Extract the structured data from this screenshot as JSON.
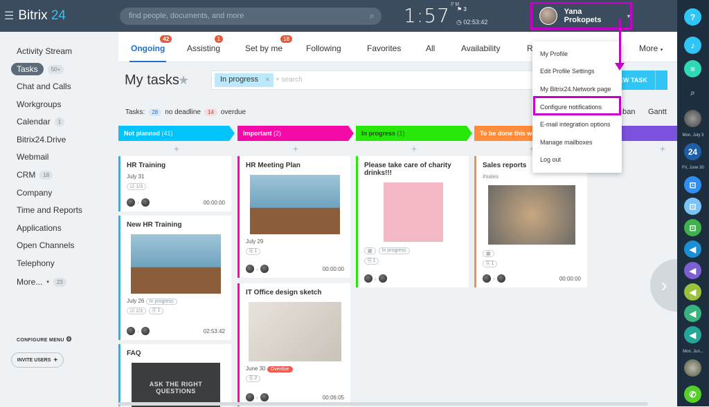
{
  "app": {
    "name_part1": "Bitrix",
    "name_part2": "24"
  },
  "search": {
    "placeholder": "find people, documents, and more"
  },
  "clock": {
    "time": "1:57",
    "ampm": "PM",
    "flags": "3",
    "timer": "02:53:42"
  },
  "user": {
    "name": "Yana Prokopets"
  },
  "sidebar": {
    "items": [
      {
        "label": "Activity Stream",
        "count": ""
      },
      {
        "label": "Tasks",
        "count": "50+"
      },
      {
        "label": "Chat and Calls",
        "count": ""
      },
      {
        "label": "Workgroups",
        "count": ""
      },
      {
        "label": "Calendar",
        "count": "1"
      },
      {
        "label": "Bitrix24.Drive",
        "count": ""
      },
      {
        "label": "Webmail",
        "count": ""
      },
      {
        "label": "CRM",
        "count": "18"
      },
      {
        "label": "Company",
        "count": ""
      },
      {
        "label": "Time and Reports",
        "count": ""
      },
      {
        "label": "Applications",
        "count": ""
      },
      {
        "label": "Open Channels",
        "count": ""
      },
      {
        "label": "Telephony",
        "count": ""
      },
      {
        "label": "More...",
        "count": "23"
      }
    ],
    "configure_menu": "CONFIGURE MENU",
    "invite_users": "INVITE USERS"
  },
  "tabs": [
    {
      "label": "Ongoing",
      "badge": "42"
    },
    {
      "label": "Assisting",
      "badge": "1"
    },
    {
      "label": "Set by me",
      "badge": "18"
    },
    {
      "label": "Following",
      "badge": ""
    },
    {
      "label": "Favorites",
      "badge": ""
    },
    {
      "label": "All",
      "badge": ""
    },
    {
      "label": "Availability",
      "badge": ""
    },
    {
      "label": "R",
      "badge": ""
    },
    {
      "label": "More",
      "badge": ""
    }
  ],
  "page": {
    "title": "My tasks"
  },
  "filter": {
    "chip": "In progress",
    "placeholder": "+ search"
  },
  "new_task": "EW TASK",
  "meta": {
    "label": "Tasks:",
    "no_deadline_count": "28",
    "no_deadline": "no deadline",
    "overdue_count": "14",
    "overdue": "overdue"
  },
  "views": {
    "kanban": "nban",
    "gantt": "Gantt"
  },
  "columns": [
    {
      "title": "Not planned",
      "count": "(41)",
      "color": "#00c4fb"
    },
    {
      "title": "Important",
      "count": "(2)",
      "color": "#f40ba7"
    },
    {
      "title": "In progress",
      "count": "(1)",
      "color": "#28e80a"
    },
    {
      "title": "To be done this we",
      "count": "",
      "color": "#ff8c3b"
    },
    {
      "title": "",
      "count": "",
      "color": "#7b52de"
    }
  ],
  "cards": {
    "c1": {
      "title": "HR Training",
      "date": "July 31",
      "checklist": "1/3",
      "time": "00:00:00"
    },
    "c2": {
      "title": "New HR Training",
      "date": "July 26",
      "status": "In progress",
      "checklist": "2/3",
      "files": "1",
      "time": "02:53:42"
    },
    "c3": {
      "title": "FAQ",
      "img_text": "ASK THE RIGHT QUESTIONS"
    },
    "c4": {
      "title": "HR Meeting Plan",
      "date": "July 29",
      "files": "1",
      "time": "00:00:00"
    },
    "c5": {
      "title": "IT Office design sketch",
      "date": "June 30",
      "overdue": "Overdue",
      "files": "2",
      "time": "00:06:05"
    },
    "c6": {
      "title": "Please take care of charity drinks!!!",
      "status": "In progress",
      "files": "1"
    },
    "c7": {
      "title": "Sales reports",
      "tag": "#sales",
      "files": "1",
      "time": "00:00:00"
    }
  },
  "menu": {
    "items": [
      "My Profile",
      "Edit Profile Settings",
      "My Bitrix24.Network page",
      "Configure notifications",
      "E-mail integration options",
      "Manage mailboxes",
      "Log out"
    ]
  },
  "rightbar": {
    "dates": [
      "Mon, July 3",
      "Fri, June 30",
      "Mon, Jun..."
    ],
    "day_24": "24"
  },
  "colors": {
    "highlight": "#c600c8",
    "accent": "#1e6fd0",
    "topbar": "#3a4c5e"
  }
}
